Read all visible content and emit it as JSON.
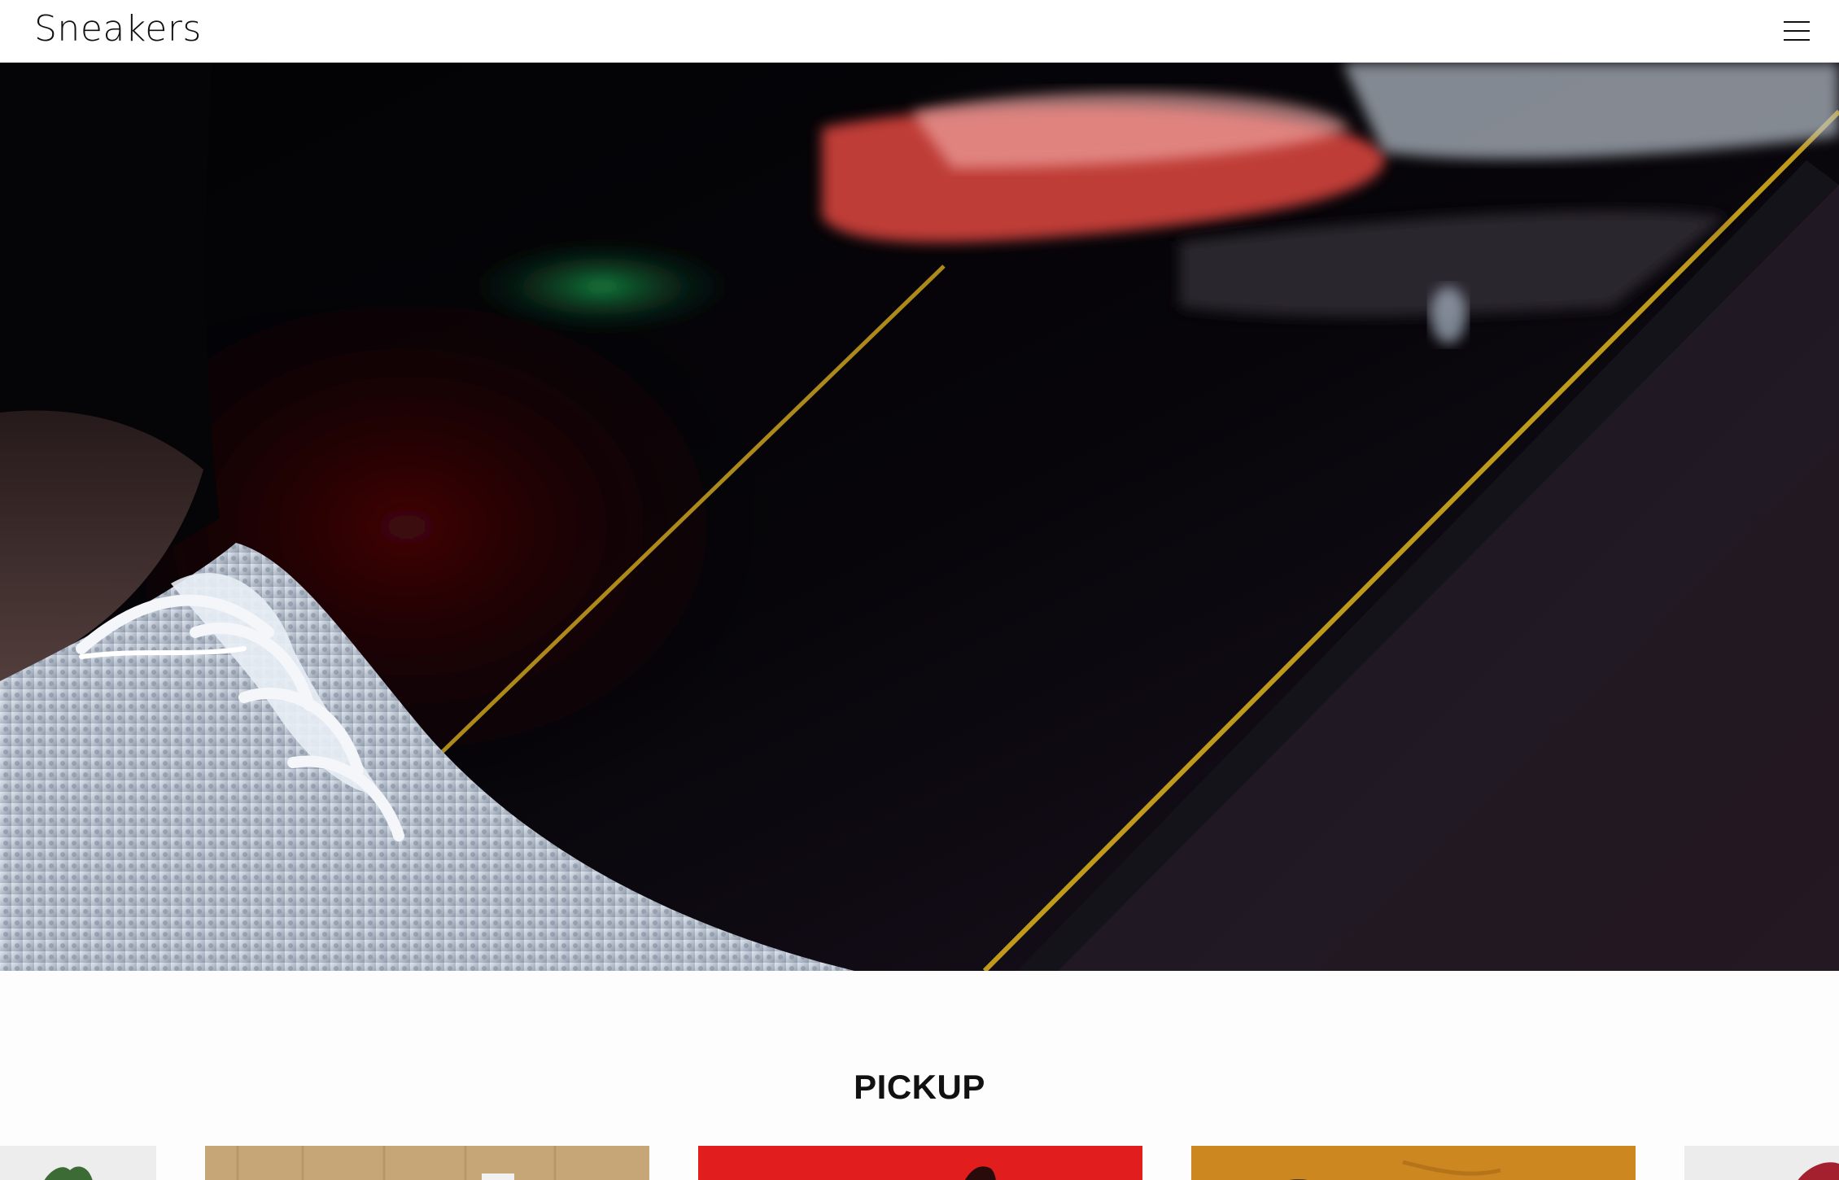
{
  "header": {
    "logo_text": "Sneakers",
    "menu_icon": "hamburger-menu-icon"
  },
  "hero": {
    "media": "video-background"
  },
  "pickup": {
    "title": "PICKUP",
    "cards": [
      {
        "id": "card-1",
        "tone": "#eeeeee",
        "accent": "#3c6b35"
      },
      {
        "id": "card-2",
        "tone": "#c8a879",
        "accent": "#f2f2f2"
      },
      {
        "id": "card-3",
        "tone": "#e01b1b",
        "accent": "#2a0b0b"
      },
      {
        "id": "card-4",
        "tone": "#cf8a22",
        "accent": "#1a1a1a"
      },
      {
        "id": "card-5",
        "tone": "#ececec",
        "accent": "#a5202e"
      }
    ]
  }
}
